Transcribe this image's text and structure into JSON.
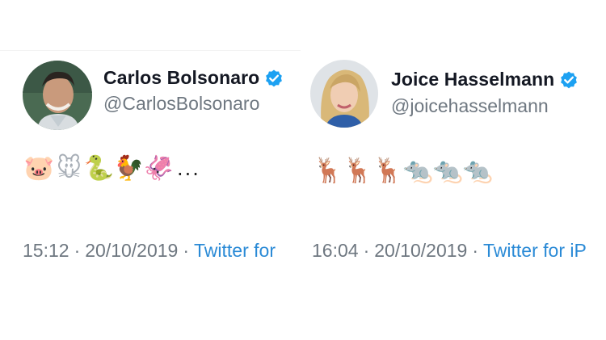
{
  "tweets": [
    {
      "name": "Carlos Bolsonaro",
      "handle": "@CarlosBolsonaro",
      "verified": true,
      "emojis": [
        "pig-face",
        "mouse-face",
        "snake",
        "rooster",
        "squid"
      ],
      "trailing": "...",
      "time": "15:12",
      "separator": "·",
      "date": "20/10/2019",
      "source": "Twitter for"
    },
    {
      "name": "Joice Hasselmann",
      "handle": "@joicehasselmann",
      "verified": true,
      "emojis": [
        "deer",
        "deer",
        "deer",
        "white-rat",
        "rat",
        "rat"
      ],
      "time": "16:04",
      "separator": "·",
      "date": "20/10/2019",
      "source": "Twitter for iP"
    }
  ],
  "colors": {
    "text": "#141823",
    "muted": "#6e7780",
    "link": "#2a8ad6",
    "verified": "#1da1f2"
  }
}
